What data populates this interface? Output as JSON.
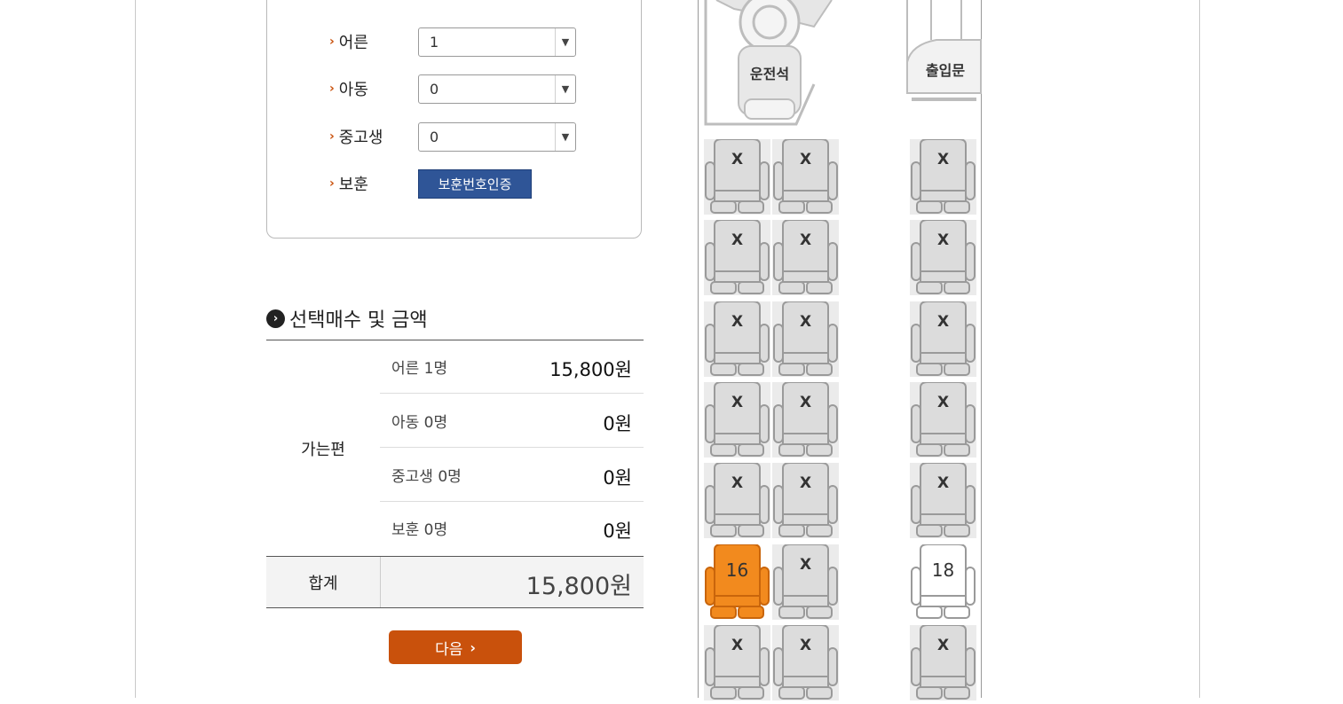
{
  "passenger_form": {
    "rows": [
      {
        "label": "어른",
        "value": "1"
      },
      {
        "label": "아동",
        "value": "0"
      },
      {
        "label": "중고생",
        "value": "0"
      }
    ],
    "veteran": {
      "label": "보훈",
      "button_label": "보훈번호인증"
    }
  },
  "summary": {
    "title": "선택매수 및 금액",
    "direction": "가는편",
    "rows": [
      {
        "label": "어른 1명",
        "amount": "15,800원"
      },
      {
        "label": "아동 0명",
        "amount": "0원"
      },
      {
        "label": "중고생 0명",
        "amount": "0원"
      },
      {
        "label": "보훈 0명",
        "amount": "0원"
      }
    ],
    "total_label": "합계",
    "total_amount": "15,800원",
    "next_label": "다음"
  },
  "bus": {
    "driver_label": "운전석",
    "door_label": "출입문",
    "seats": [
      {
        "label": "X",
        "status": "sold"
      },
      {
        "label": "X",
        "status": "sold"
      },
      {
        "label": "X",
        "status": "sold"
      },
      {
        "label": "X",
        "status": "sold"
      },
      {
        "label": "X",
        "status": "sold"
      },
      {
        "label": "X",
        "status": "sold"
      },
      {
        "label": "X",
        "status": "sold"
      },
      {
        "label": "X",
        "status": "sold"
      },
      {
        "label": "X",
        "status": "sold"
      },
      {
        "label": "X",
        "status": "sold"
      },
      {
        "label": "X",
        "status": "sold"
      },
      {
        "label": "X",
        "status": "sold"
      },
      {
        "label": "X",
        "status": "sold"
      },
      {
        "label": "X",
        "status": "sold"
      },
      {
        "label": "X",
        "status": "sold"
      },
      {
        "label": "16",
        "status": "selected"
      },
      {
        "label": "X",
        "status": "sold"
      },
      {
        "label": "18",
        "status": "available"
      },
      {
        "label": "X",
        "status": "sold"
      },
      {
        "label": "X",
        "status": "sold"
      },
      {
        "label": "X",
        "status": "sold"
      }
    ],
    "colors": {
      "selected": "#f28a1e",
      "available": "#ffffff",
      "sold": "#dcdcdc"
    }
  }
}
